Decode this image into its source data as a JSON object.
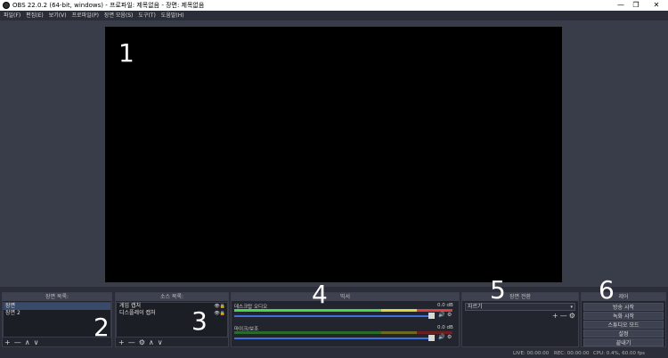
{
  "window": {
    "title": "OBS 22.0.2 (64-bit, windows) - 프로파일: 제목없음 - 장면: 제목없음",
    "minimize": "—",
    "maximize": "❐",
    "close": "✕"
  },
  "menu": [
    "파일(F)",
    "편집(E)",
    "보기(V)",
    "프로파일(P)",
    "장면 모음(S)",
    "도구(T)",
    "도움말(H)"
  ],
  "annotations": [
    "1",
    "2",
    "3",
    "4",
    "5",
    "6"
  ],
  "docks": {
    "scenes": {
      "title": "장면 목록:",
      "items": [
        "장면",
        "장면 2"
      ],
      "toolbar": [
        "+",
        "—",
        "∧",
        "∨"
      ]
    },
    "sources": {
      "title": "소스 목록:",
      "items": [
        "게임 캡처",
        "디스플레이 캡처"
      ],
      "toolbar": [
        "+",
        "—",
        "⚙",
        "∧",
        "∨"
      ]
    },
    "mixer": {
      "title": "믹서",
      "channels": [
        {
          "name": "데스크탑 오디오",
          "level": "0.0 dB"
        },
        {
          "name": "마이크/보조",
          "level": "0.0 dB"
        }
      ]
    },
    "transitions": {
      "title": "장면 전환",
      "selected": "자르기",
      "toolbar": [
        "+",
        "—",
        "⚙"
      ]
    },
    "controls": {
      "title": "제어",
      "buttons": [
        "방송 시작",
        "녹화 시작",
        "스튜디오 모드",
        "설정",
        "끝내기"
      ]
    }
  },
  "status": {
    "live": "LIVE: 00:00:00",
    "rec": "REC: 00:00:00",
    "cpu": "CPU: 0.4%, 60.00 fps"
  },
  "colors": {
    "meter_green": "#4cd44c",
    "meter_yellow": "#d8d840",
    "meter_red": "#d84040",
    "volume_track": "#3f6fd8"
  }
}
